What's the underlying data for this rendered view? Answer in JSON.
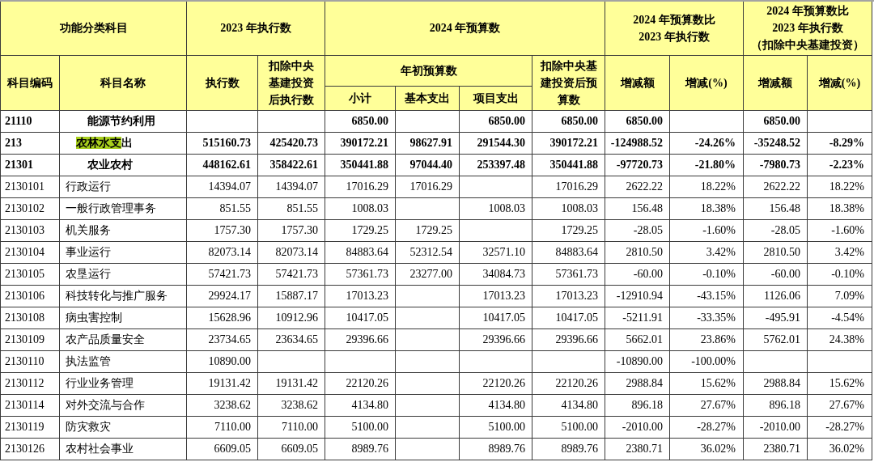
{
  "table": {
    "header_groups": [
      {
        "label": "功能分类科目",
        "columns": [
          {
            "label": "科目编码"
          },
          {
            "label": "科目名称"
          }
        ]
      },
      {
        "label": "2023 年执行数",
        "columns": [
          {
            "label": "执行数"
          },
          {
            "label": "扣除中央基建投资后执行数"
          }
        ]
      },
      {
        "label": "2024 年预算数",
        "columns": [
          {
            "label": "年初预算数",
            "columns": [
              {
                "label": "小计"
              },
              {
                "label": "基本支出"
              },
              {
                "label": "项目支出"
              }
            ]
          },
          {
            "label": "扣除中央基建投资后预算数"
          }
        ]
      },
      {
        "label": "2024 年预算数比 2023 年执行数",
        "columns": [
          {
            "label": "增减额"
          },
          {
            "label": "增减(%)"
          }
        ]
      },
      {
        "label": "2024 年预算数比 2023 年执行数",
        "note": "（扣除中央基建投资）",
        "columns": [
          {
            "label": "增减额"
          },
          {
            "label": "增减(%)"
          }
        ]
      }
    ],
    "rows": [
      {
        "kind": "subcategory",
        "code": "21110",
        "name": "能源节约利用",
        "values": {
          "subtotal": "6850.00",
          "project": "6850.00",
          "budget_excl": "6850.00",
          "diff": "6850.00",
          "diff_excl": "6850.00"
        }
      },
      {
        "kind": "category",
        "code": "213",
        "name_parts": [
          {
            "text": "农林水支",
            "highlighted": true
          },
          {
            "text": "出",
            "highlighted": false
          }
        ],
        "values": {
          "exec": "515160.73",
          "exec_excl": "425420.73",
          "subtotal": "390172.21",
          "basic": "98627.91",
          "project": "291544.30",
          "budget_excl": "390172.21",
          "diff": "-124988.52",
          "diff_pct": "-24.26%",
          "diff_excl": "-35248.52",
          "diff_pct_excl": "-8.29%"
        }
      },
      {
        "kind": "subcategory",
        "code": "21301",
        "name": "农业农村",
        "values": {
          "exec": "448162.61",
          "exec_excl": "358422.61",
          "subtotal": "350441.88",
          "basic": "97044.40",
          "project": "253397.48",
          "budget_excl": "350441.88",
          "diff": "-97720.73",
          "diff_pct": "-21.80%",
          "diff_excl": "-7980.73",
          "diff_pct_excl": "-2.23%"
        }
      },
      {
        "kind": "item",
        "code": "2130101",
        "name": "行政运行",
        "values": {
          "exec": "14394.07",
          "exec_excl": "14394.07",
          "subtotal": "17016.29",
          "basic": "17016.29",
          "budget_excl": "17016.29",
          "diff": "2622.22",
          "diff_pct": "18.22%",
          "diff_excl": "2622.22",
          "diff_pct_excl": "18.22%"
        }
      },
      {
        "kind": "item",
        "code": "2130102",
        "name": "一般行政管理事务",
        "values": {
          "exec": "851.55",
          "exec_excl": "851.55",
          "subtotal": "1008.03",
          "project": "1008.03",
          "budget_excl": "1008.03",
          "diff": "156.48",
          "diff_pct": "18.38%",
          "diff_excl": "156.48",
          "diff_pct_excl": "18.38%"
        }
      },
      {
        "kind": "item",
        "code": "2130103",
        "name": "机关服务",
        "values": {
          "exec": "1757.30",
          "exec_excl": "1757.30",
          "subtotal": "1729.25",
          "basic": "1729.25",
          "budget_excl": "1729.25",
          "diff": "-28.05",
          "diff_pct": "-1.60%",
          "diff_excl": "-28.05",
          "diff_pct_excl": "-1.60%"
        }
      },
      {
        "kind": "item",
        "code": "2130104",
        "name": "事业运行",
        "values": {
          "exec": "82073.14",
          "exec_excl": "82073.14",
          "subtotal": "84883.64",
          "basic": "52312.54",
          "project": "32571.10",
          "budget_excl": "84883.64",
          "diff": "2810.50",
          "diff_pct": "3.42%",
          "diff_excl": "2810.50",
          "diff_pct_excl": "3.42%"
        }
      },
      {
        "kind": "item",
        "code": "2130105",
        "name": "农垦运行",
        "values": {
          "exec": "57421.73",
          "exec_excl": "57421.73",
          "subtotal": "57361.73",
          "basic": "23277.00",
          "project": "34084.73",
          "budget_excl": "57361.73",
          "diff": "-60.00",
          "diff_pct": "-0.10%",
          "diff_excl": "-60.00",
          "diff_pct_excl": "-0.10%"
        }
      },
      {
        "kind": "item",
        "code": "2130106",
        "name": "科技转化与推广服务",
        "values": {
          "exec": "29924.17",
          "exec_excl": "15887.17",
          "subtotal": "17013.23",
          "project": "17013.23",
          "budget_excl": "17013.23",
          "diff": "-12910.94",
          "diff_pct": "-43.15%",
          "diff_excl": "1126.06",
          "diff_pct_excl": "7.09%"
        }
      },
      {
        "kind": "item",
        "code": "2130108",
        "name": "病虫害控制",
        "values": {
          "exec": "15628.96",
          "exec_excl": "10912.96",
          "subtotal": "10417.05",
          "project": "10417.05",
          "budget_excl": "10417.05",
          "diff": "-5211.91",
          "diff_pct": "-33.35%",
          "diff_excl": "-495.91",
          "diff_pct_excl": "-4.54%"
        }
      },
      {
        "kind": "item",
        "code": "2130109",
        "name": "农产品质量安全",
        "values": {
          "exec": "23734.65",
          "exec_excl": "23634.65",
          "subtotal": "29396.66",
          "project": "29396.66",
          "budget_excl": "29396.66",
          "diff": "5662.01",
          "diff_pct": "23.86%",
          "diff_excl": "5762.01",
          "diff_pct_excl": "24.38%"
        }
      },
      {
        "kind": "item",
        "code": "2130110",
        "name": "执法监管",
        "values": {
          "exec": "10890.00",
          "diff": "-10890.00",
          "diff_pct": "-100.00%"
        }
      },
      {
        "kind": "item",
        "code": "2130112",
        "name": "行业业务管理",
        "values": {
          "exec": "19131.42",
          "exec_excl": "19131.42",
          "subtotal": "22120.26",
          "project": "22120.26",
          "budget_excl": "22120.26",
          "diff": "2988.84",
          "diff_pct": "15.62%",
          "diff_excl": "2988.84",
          "diff_pct_excl": "15.62%"
        }
      },
      {
        "kind": "item",
        "code": "2130114",
        "name": "对外交流与合作",
        "values": {
          "exec": "3238.62",
          "exec_excl": "3238.62",
          "subtotal": "4134.80",
          "project": "4134.80",
          "budget_excl": "4134.80",
          "diff": "896.18",
          "diff_pct": "27.67%",
          "diff_excl": "896.18",
          "diff_pct_excl": "27.67%"
        }
      },
      {
        "kind": "item",
        "code": "2130119",
        "name": "防灾救灾",
        "values": {
          "exec": "7110.00",
          "exec_excl": "7110.00",
          "subtotal": "5100.00",
          "project": "5100.00",
          "budget_excl": "5100.00",
          "diff": "-2010.00",
          "diff_pct": "-28.27%",
          "diff_excl": "-2010.00",
          "diff_pct_excl": "-28.27%"
        }
      },
      {
        "kind": "item",
        "code": "2130126",
        "name": "农村社会事业",
        "values": {
          "exec": "6609.05",
          "exec_excl": "6609.05",
          "subtotal": "8989.76",
          "project": "8989.76",
          "budget_excl": "8989.76",
          "diff": "2380.71",
          "diff_pct": "36.02%",
          "diff_excl": "2380.71",
          "diff_pct_excl": "36.02%"
        }
      }
    ]
  }
}
